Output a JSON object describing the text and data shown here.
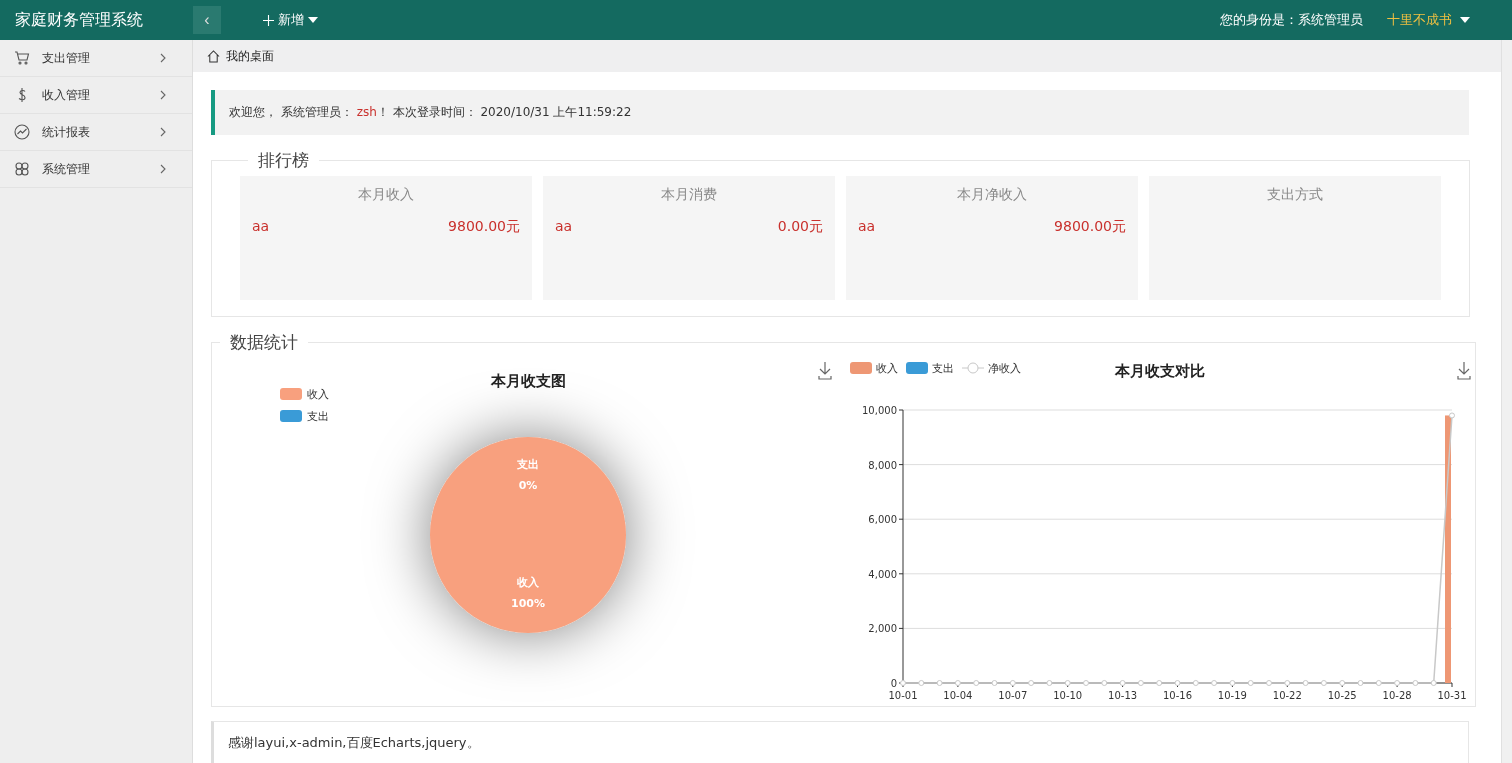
{
  "header": {
    "title": "家庭财务管理系统",
    "collapse_icon": "‹",
    "add_menu": "新增",
    "identity": "您的身份是：系统管理员",
    "user_menu": "十里不成书"
  },
  "sidebar": {
    "items": [
      {
        "label": "支出管理",
        "expanded": false
      },
      {
        "label": "收入管理",
        "expanded": false
      },
      {
        "label": "统计报表",
        "expanded": false
      },
      {
        "label": "系统管理",
        "expanded": false
      }
    ]
  },
  "tabs": [
    {
      "label": "我的桌面",
      "selected": true
    }
  ],
  "welcome": "欢迎您， 系统管理员： **zsh**！ 本次登录时间： 2020/10/31 上午11:59:22",
  "ranking": {
    "title": "排行榜",
    "cards": [
      {
        "title": "本月收入",
        "name": "aa",
        "amount": "9800.00元"
      },
      {
        "title": "本月消费",
        "name": "aa",
        "amount": "0.00元"
      },
      {
        "title": "本月净收入",
        "name": "aa",
        "amount": "9800.00元"
      },
      {
        "title": "支出方式"
      }
    ]
  },
  "stats": {
    "title": "数据统计",
    "pie_chart": {
      "chart_data": {
        "type": "pie",
        "title": "本月收支图",
        "categories": [
          "收入",
          "支出"
        ],
        "values": [
          100,
          0
        ],
        "value_labels": [
          "100%",
          "0%"
        ]
      }
    },
    "compare_chart": {
      "chart_data": {
        "type": "bar",
        "title": "本月收支对比",
        "categories": [
          "10-01",
          null,
          null,
          "10-04",
          null,
          null,
          "10-07",
          null,
          null,
          "10-10",
          null,
          null,
          "10-13",
          null,
          null,
          "10-16",
          null,
          null,
          "10-19",
          null,
          null,
          "10-22",
          null,
          null,
          "10-25",
          null,
          null,
          "10-28",
          null,
          null,
          "10-31"
        ],
        "ylim": [
          0,
          10000
        ],
        "yticks": [
          {
            "value": 0,
            "label": "0"
          },
          {
            "value": 2000,
            "label": "2,000"
          },
          {
            "value": 4000,
            "label": "4,000"
          },
          {
            "value": 6000,
            "label": "6,000"
          },
          {
            "value": 8000,
            "label": "8,000"
          },
          {
            "value": 10000,
            "label": "10,000"
          }
        ],
        "grid": true,
        "legend": "upper left",
        "series": [
          {
            "name": "收入",
            "color": "#ee9774",
            "values": [
              0,
              0,
              0,
              0,
              0,
              0,
              0,
              0,
              0,
              0,
              0,
              0,
              0,
              0,
              0,
              0,
              0,
              0,
              0,
              0,
              0,
              0,
              0,
              0,
              0,
              0,
              0,
              0,
              0,
              0,
              9800
            ]
          },
          {
            "name": "支出",
            "color": "#3a9bd7",
            "values": [
              0,
              0,
              0,
              0,
              0,
              0,
              0,
              0,
              0,
              0,
              0,
              0,
              0,
              0,
              0,
              0,
              0,
              0,
              0,
              0,
              0,
              0,
              0,
              0,
              0,
              0,
              0,
              0,
              0,
              0,
              0
            ]
          },
          {
            "name": "净收入",
            "type": "line",
            "marker": "circle",
            "color": "#c8c8c8",
            "values": [
              0,
              0,
              0,
              0,
              0,
              0,
              0,
              0,
              0,
              0,
              0,
              0,
              0,
              0,
              0,
              0,
              0,
              0,
              0,
              0,
              0,
              0,
              0,
              0,
              0,
              0,
              0,
              0,
              0,
              0,
              9800
            ]
          }
        ]
      }
    }
  },
  "footer": "感谢layui,x-admin,百度Echarts,jquery。"
}
